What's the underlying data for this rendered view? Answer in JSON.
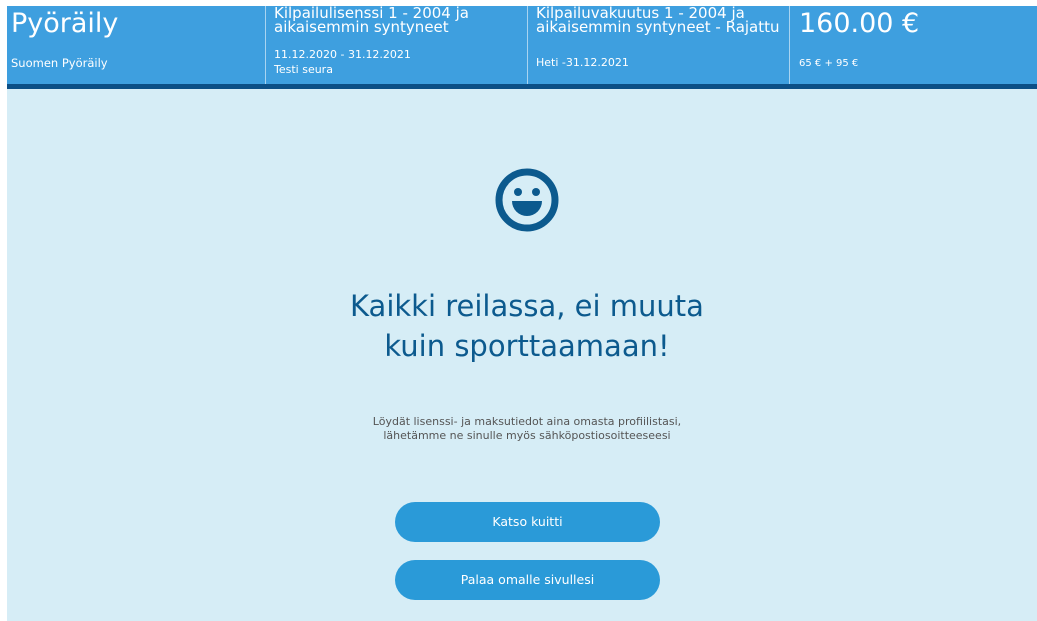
{
  "header": {
    "brand": {
      "title": "Pyöräily",
      "subtitle": "Suomen Pyöräily"
    },
    "license": {
      "title": "Kilpailulisenssi 1 - 2004 ja aikaisemmin syntyneet",
      "dates": "11.12.2020 - 31.12.2021",
      "club": "Testi seura"
    },
    "insurance": {
      "title": "Kilpailuvakuutus 1 - 2004 ja aikaisemmin syntyneet - Rajattu",
      "dates": "Heti -31.12.2021"
    },
    "price": {
      "total": "160.00 €",
      "breakdown": "65 € + 95 €"
    }
  },
  "main": {
    "icon": "smiley-face-icon",
    "headline": "Kaikki reilassa, ei muuta kuin sporttaamaan!",
    "info": "Löydät lisenssi- ja maksutiedot aina omasta profiilistasi, lähetämme ne sinulle myös sähköpostiosoitteeseesi",
    "receipt_button": "Katso kuitti",
    "back_button": "Palaa omalle sivullesi"
  },
  "colors": {
    "header_bg": "#3e9fdf",
    "header_border": "#0b4f86",
    "page_bg": "#d6edf6",
    "accent_dark": "#0c5a8e",
    "button_bg": "#2a9ad8"
  }
}
